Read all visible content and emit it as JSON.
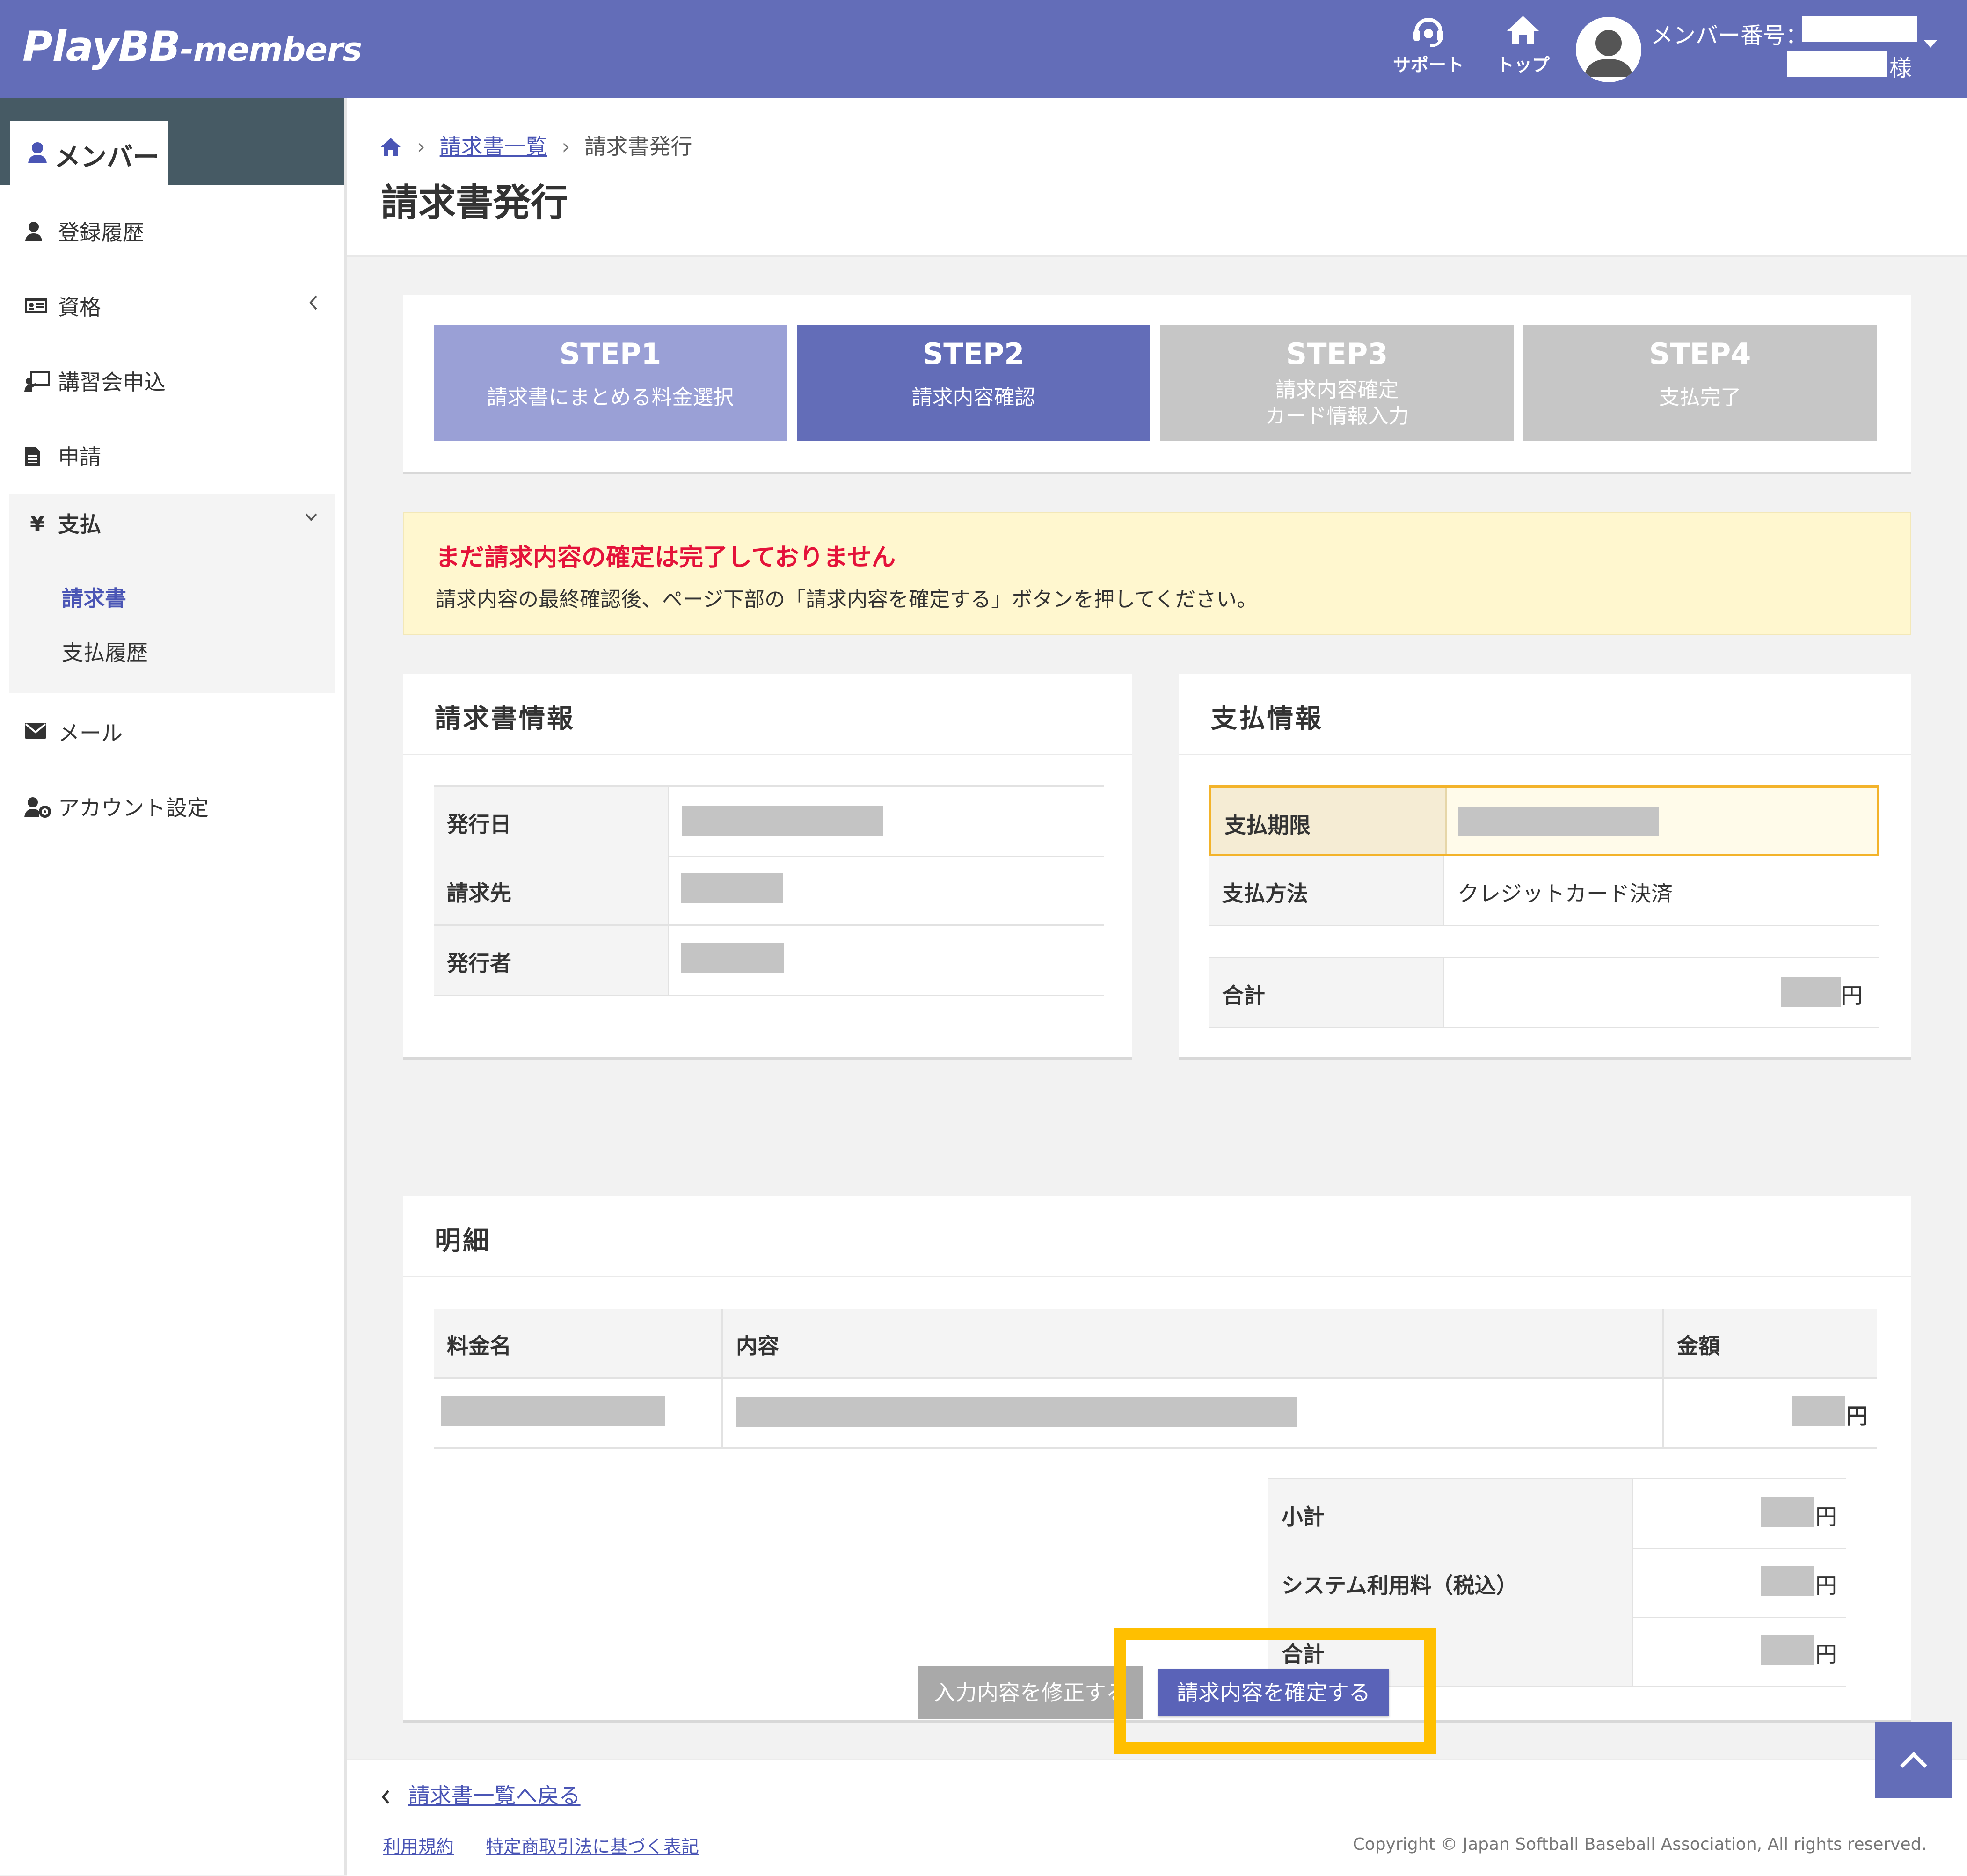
{
  "header": {
    "logo_main": "PlayBB",
    "logo_sub": "-members",
    "support_label": "サポート",
    "top_label": "トップ",
    "member_no_label": "メンバー番号：",
    "honorific": "様"
  },
  "sidebar": {
    "tab_label": "メンバー",
    "items": [
      {
        "label": "登録履歴",
        "icon": "user-icon"
      },
      {
        "label": "資格",
        "icon": "id-card-icon"
      },
      {
        "label": "講習会申込",
        "icon": "chalkboard-icon"
      },
      {
        "label": "申請",
        "icon": "document-icon"
      }
    ],
    "payment": {
      "icon": "¥",
      "label": "支払",
      "sub_items": [
        "請求書",
        "支払履歴"
      ]
    },
    "mail_label": "メール",
    "account_label": "アカウント設定"
  },
  "breadcrumb": {
    "link": "請求書一覧",
    "current": "請求書発行"
  },
  "page_title": "請求書発行",
  "steps": [
    {
      "num": "STEP1",
      "desc": "請求書にまとめる料金選択",
      "state": "done"
    },
    {
      "num": "STEP2",
      "desc": "請求内容確認",
      "state": "active"
    },
    {
      "num": "STEP3",
      "desc": "請求内容確定\nカード情報入力",
      "state": "future"
    },
    {
      "num": "STEP4",
      "desc": "支払完了",
      "state": "future"
    }
  ],
  "alert": {
    "title": "まだ請求内容の確定は完了しておりません",
    "body": "請求内容の最終確認後、ページ下部の「請求内容を確定する」ボタンを押してください。"
  },
  "invoice_info": {
    "title": "請求書情報",
    "rows": [
      {
        "label": "発行日"
      },
      {
        "label": "請求先"
      },
      {
        "label": "発行者"
      }
    ]
  },
  "payment_info": {
    "title": "支払情報",
    "due_label": "支払期限",
    "method_label": "支払方法",
    "method_value": "クレジットカード決済",
    "total_label": "合計",
    "yen": "円"
  },
  "detail": {
    "title": "明細",
    "headers": [
      "料金名",
      "内容",
      "金額"
    ],
    "yen": "円",
    "summary": [
      {
        "label": "小計"
      },
      {
        "label": "システム利用料（税込）"
      },
      {
        "label": "合計"
      }
    ]
  },
  "buttons": {
    "edit": "入力内容を修正する",
    "confirm": "請求内容を確定する"
  },
  "footer": {
    "back": "請求書一覧へ戻る",
    "terms": "利用規約",
    "law": "特定商取引法に基づく表記",
    "copyright": "Copyright © Japan Softball Baseball Association, All rights reserved."
  },
  "colors": {
    "brand": "#636db8",
    "step_done": "#9aa0d6",
    "step_future": "#c6c6c6",
    "alert_bg": "#fff7cf",
    "alert_title": "#e4123a",
    "highlight": "#ffbf00"
  }
}
